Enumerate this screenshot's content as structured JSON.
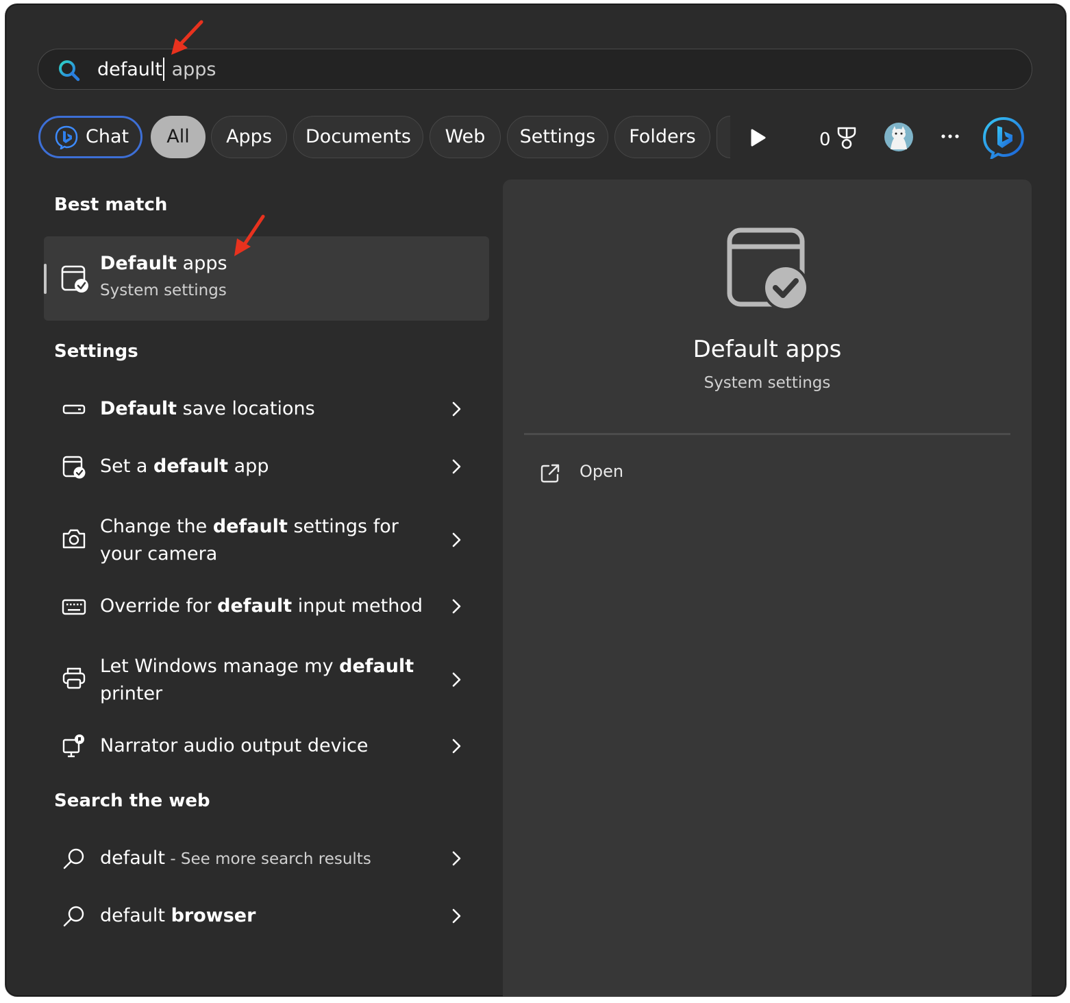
{
  "search": {
    "typed": "default",
    "suggestion": " apps"
  },
  "filters": {
    "chat": "Chat",
    "all": "All",
    "apps": "Apps",
    "documents": "Documents",
    "web": "Web",
    "settings": "Settings",
    "folders": "Folders"
  },
  "toolbar": {
    "rewards_points": "0"
  },
  "best_match": {
    "heading": "Best match",
    "title_bold": "Default",
    "title_rest": " apps",
    "subtitle": "System settings"
  },
  "settings_section": {
    "heading": "Settings",
    "items": [
      {
        "pre": "",
        "bold": "Default",
        "post": " save locations",
        "icon": "drive-icon"
      },
      {
        "pre": "Set a ",
        "bold": "default",
        "post": " app",
        "icon": "default-apps-icon"
      },
      {
        "pre": "Change the ",
        "bold": "default",
        "post": " settings for your camera",
        "icon": "camera-icon"
      },
      {
        "pre": "Override for ",
        "bold": "default",
        "post": " input method",
        "icon": "keyboard-icon"
      },
      {
        "pre": "Let Windows manage my ",
        "bold": "default",
        "post": " printer",
        "icon": "printer-icon"
      },
      {
        "pre": "Narrator audio output device",
        "bold": "",
        "post": "",
        "icon": "narrator-icon"
      }
    ]
  },
  "web_section": {
    "heading": "Search the web",
    "items": [
      {
        "main": "default",
        "suffix": " - See more search results"
      },
      {
        "main": "default ",
        "bold": "browser"
      }
    ]
  },
  "detail": {
    "title": "Default apps",
    "subtitle": "System settings",
    "open_label": "Open"
  },
  "colors": {
    "window_bg": "#2b2b2b",
    "panel_bg": "#373737",
    "accent_blue": "#3d6fd6",
    "annotation_red": "#e8321e"
  }
}
